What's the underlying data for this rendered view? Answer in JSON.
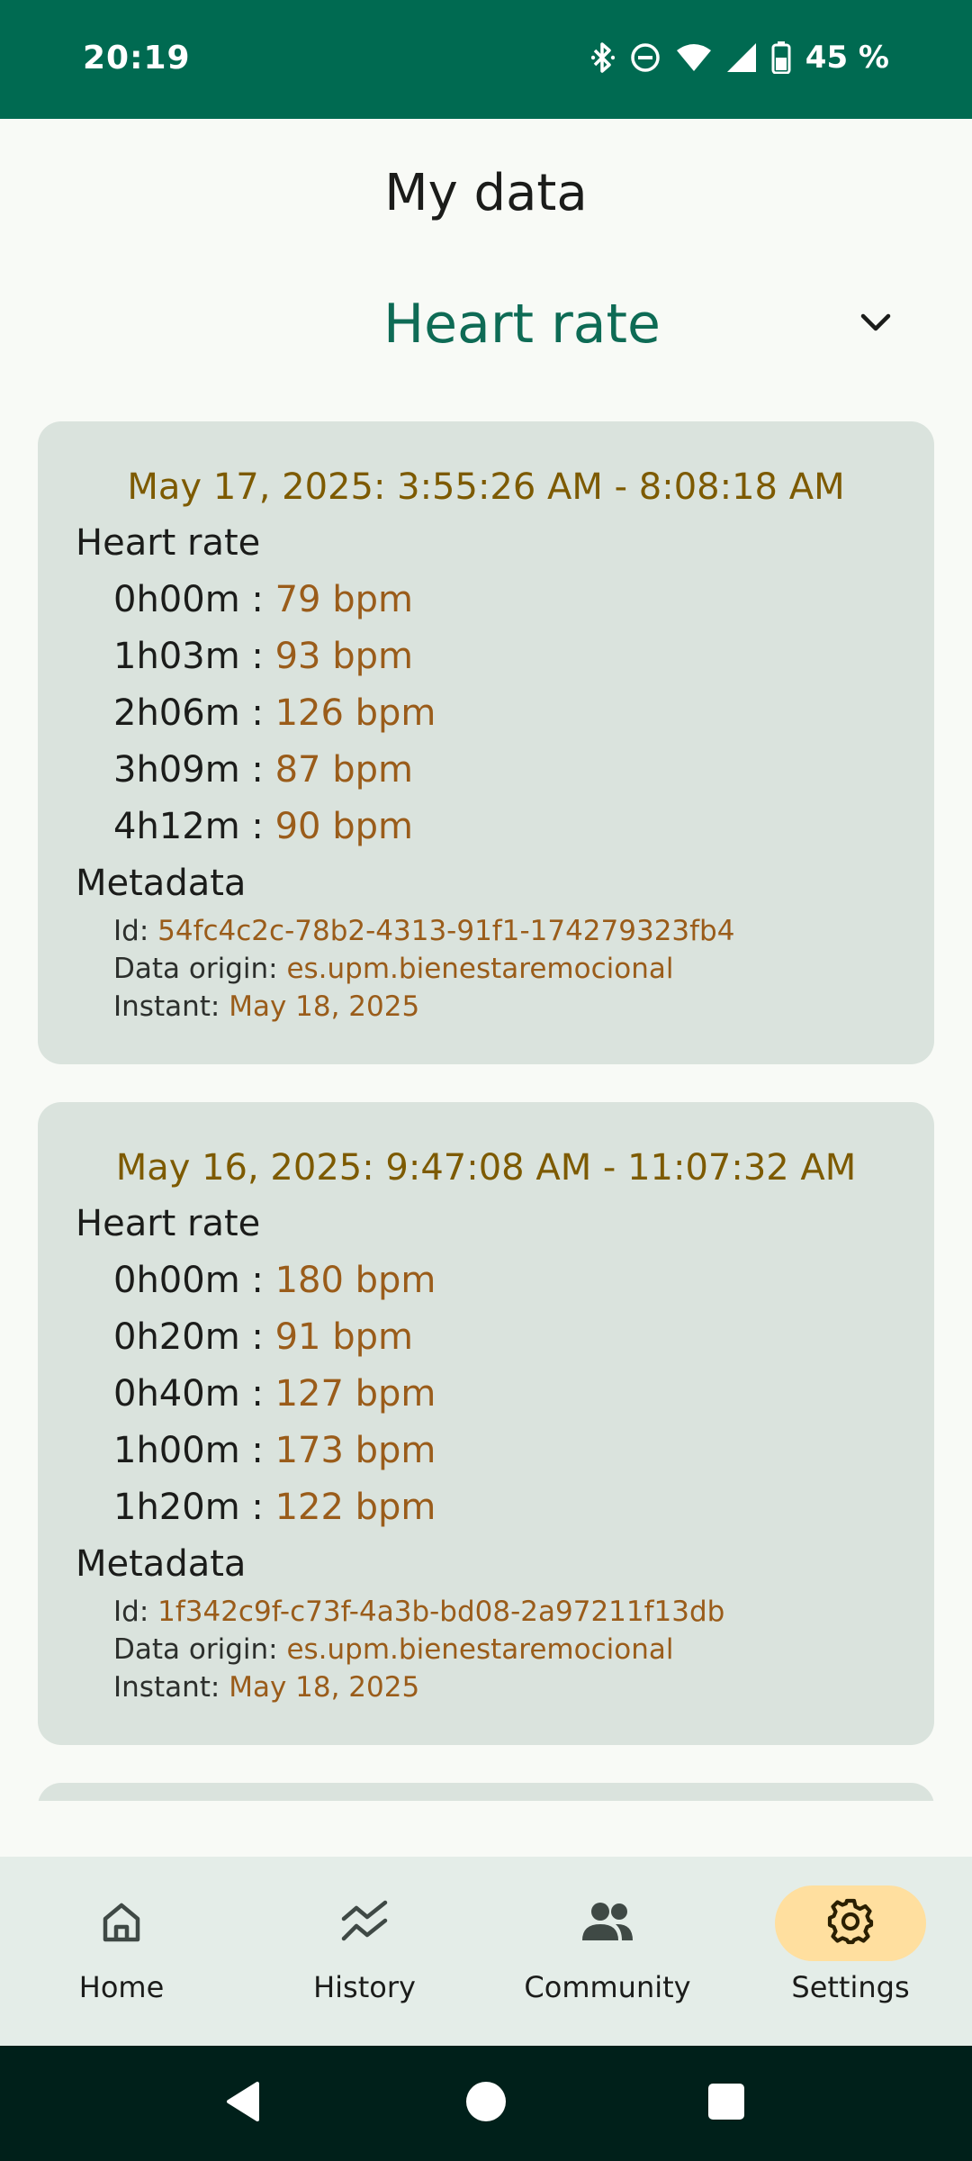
{
  "status_bar": {
    "time": "20:19",
    "battery": "45 %",
    "icons": [
      "bluetooth-icon",
      "do-not-disturb-icon",
      "wifi-icon",
      "cell-signal-icon",
      "battery-icon"
    ]
  },
  "header": {
    "title": "My data",
    "metric_selected": "Heart rate"
  },
  "records": [
    {
      "range": "May 17, 2025: 3:55:26 AM - 8:08:18 AM",
      "section_label": "Heart rate",
      "readings": [
        {
          "time": "0h00m",
          "value": "79 bpm"
        },
        {
          "time": "1h03m",
          "value": "93 bpm"
        },
        {
          "time": "2h06m",
          "value": "126 bpm"
        },
        {
          "time": "3h09m",
          "value": "87 bpm"
        },
        {
          "time": "4h12m",
          "value": "90 bpm"
        }
      ],
      "metadata_label": "Metadata",
      "metadata": {
        "id_label": "Id:",
        "id": "54fc4c2c-78b2-4313-91f1-174279323fb4",
        "origin_label": "Data origin:",
        "origin": "es.upm.bienestaremocional",
        "instant_label": "Instant:",
        "instant": "May 18, 2025"
      }
    },
    {
      "range": "May 16, 2025: 9:47:08 AM - 11:07:32 AM",
      "section_label": "Heart rate",
      "readings": [
        {
          "time": "0h00m",
          "value": "180 bpm"
        },
        {
          "time": "0h20m",
          "value": "91 bpm"
        },
        {
          "time": "0h40m",
          "value": "127 bpm"
        },
        {
          "time": "1h00m",
          "value": "173 bpm"
        },
        {
          "time": "1h20m",
          "value": "122 bpm"
        }
      ],
      "metadata_label": "Metadata",
      "metadata": {
        "id_label": "Id:",
        "id": "1f342c9f-c73f-4a3b-bd08-2a97211f13db",
        "origin_label": "Data origin:",
        "origin": "es.upm.bienestaremocional",
        "instant_label": "Instant:",
        "instant": "May 18, 2025"
      }
    }
  ],
  "bottom_nav": [
    {
      "label": "Home",
      "icon": "home-icon",
      "active": false
    },
    {
      "label": "History",
      "icon": "history-icon",
      "active": false
    },
    {
      "label": "Community",
      "icon": "community-icon",
      "active": false
    },
    {
      "label": "Settings",
      "icon": "gear-icon",
      "active": true
    }
  ],
  "colors": {
    "status_bar": "#006a51",
    "accent": "#0e6b55",
    "card_bg": "#dae3dd",
    "value_text": "#9a5c1a",
    "range_text": "#7d5a00",
    "active_pill": "#ffdf9f"
  }
}
